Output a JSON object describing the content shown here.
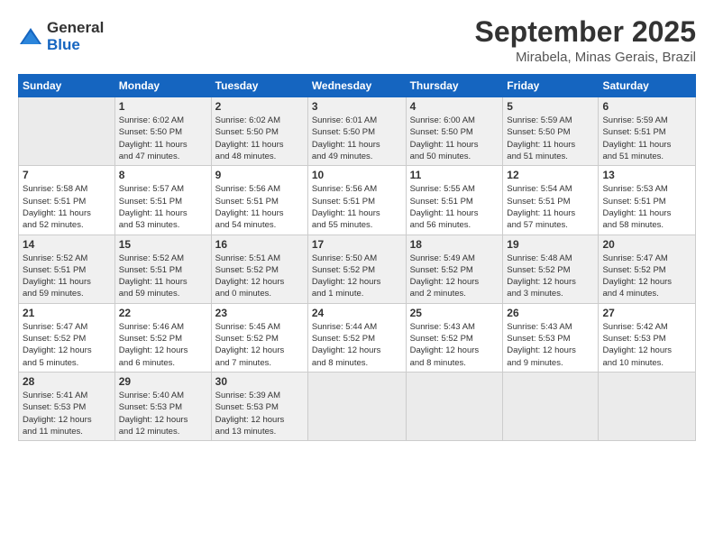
{
  "logo": {
    "general": "General",
    "blue": "Blue"
  },
  "title": "September 2025",
  "subtitle": "Mirabela, Minas Gerais, Brazil",
  "weekdays": [
    "Sunday",
    "Monday",
    "Tuesday",
    "Wednesday",
    "Thursday",
    "Friday",
    "Saturday"
  ],
  "weeks": [
    [
      {
        "day": "",
        "info": ""
      },
      {
        "day": "1",
        "info": "Sunrise: 6:02 AM\nSunset: 5:50 PM\nDaylight: 11 hours\nand 47 minutes."
      },
      {
        "day": "2",
        "info": "Sunrise: 6:02 AM\nSunset: 5:50 PM\nDaylight: 11 hours\nand 48 minutes."
      },
      {
        "day": "3",
        "info": "Sunrise: 6:01 AM\nSunset: 5:50 PM\nDaylight: 11 hours\nand 49 minutes."
      },
      {
        "day": "4",
        "info": "Sunrise: 6:00 AM\nSunset: 5:50 PM\nDaylight: 11 hours\nand 50 minutes."
      },
      {
        "day": "5",
        "info": "Sunrise: 5:59 AM\nSunset: 5:50 PM\nDaylight: 11 hours\nand 51 minutes."
      },
      {
        "day": "6",
        "info": "Sunrise: 5:59 AM\nSunset: 5:51 PM\nDaylight: 11 hours\nand 51 minutes."
      }
    ],
    [
      {
        "day": "7",
        "info": "Sunrise: 5:58 AM\nSunset: 5:51 PM\nDaylight: 11 hours\nand 52 minutes."
      },
      {
        "day": "8",
        "info": "Sunrise: 5:57 AM\nSunset: 5:51 PM\nDaylight: 11 hours\nand 53 minutes."
      },
      {
        "day": "9",
        "info": "Sunrise: 5:56 AM\nSunset: 5:51 PM\nDaylight: 11 hours\nand 54 minutes."
      },
      {
        "day": "10",
        "info": "Sunrise: 5:56 AM\nSunset: 5:51 PM\nDaylight: 11 hours\nand 55 minutes."
      },
      {
        "day": "11",
        "info": "Sunrise: 5:55 AM\nSunset: 5:51 PM\nDaylight: 11 hours\nand 56 minutes."
      },
      {
        "day": "12",
        "info": "Sunrise: 5:54 AM\nSunset: 5:51 PM\nDaylight: 11 hours\nand 57 minutes."
      },
      {
        "day": "13",
        "info": "Sunrise: 5:53 AM\nSunset: 5:51 PM\nDaylight: 11 hours\nand 58 minutes."
      }
    ],
    [
      {
        "day": "14",
        "info": "Sunrise: 5:52 AM\nSunset: 5:51 PM\nDaylight: 11 hours\nand 59 minutes."
      },
      {
        "day": "15",
        "info": "Sunrise: 5:52 AM\nSunset: 5:51 PM\nDaylight: 11 hours\nand 59 minutes."
      },
      {
        "day": "16",
        "info": "Sunrise: 5:51 AM\nSunset: 5:52 PM\nDaylight: 12 hours\nand 0 minutes."
      },
      {
        "day": "17",
        "info": "Sunrise: 5:50 AM\nSunset: 5:52 PM\nDaylight: 12 hours\nand 1 minute."
      },
      {
        "day": "18",
        "info": "Sunrise: 5:49 AM\nSunset: 5:52 PM\nDaylight: 12 hours\nand 2 minutes."
      },
      {
        "day": "19",
        "info": "Sunrise: 5:48 AM\nSunset: 5:52 PM\nDaylight: 12 hours\nand 3 minutes."
      },
      {
        "day": "20",
        "info": "Sunrise: 5:47 AM\nSunset: 5:52 PM\nDaylight: 12 hours\nand 4 minutes."
      }
    ],
    [
      {
        "day": "21",
        "info": "Sunrise: 5:47 AM\nSunset: 5:52 PM\nDaylight: 12 hours\nand 5 minutes."
      },
      {
        "day": "22",
        "info": "Sunrise: 5:46 AM\nSunset: 5:52 PM\nDaylight: 12 hours\nand 6 minutes."
      },
      {
        "day": "23",
        "info": "Sunrise: 5:45 AM\nSunset: 5:52 PM\nDaylight: 12 hours\nand 7 minutes."
      },
      {
        "day": "24",
        "info": "Sunrise: 5:44 AM\nSunset: 5:52 PM\nDaylight: 12 hours\nand 8 minutes."
      },
      {
        "day": "25",
        "info": "Sunrise: 5:43 AM\nSunset: 5:52 PM\nDaylight: 12 hours\nand 8 minutes."
      },
      {
        "day": "26",
        "info": "Sunrise: 5:43 AM\nSunset: 5:53 PM\nDaylight: 12 hours\nand 9 minutes."
      },
      {
        "day": "27",
        "info": "Sunrise: 5:42 AM\nSunset: 5:53 PM\nDaylight: 12 hours\nand 10 minutes."
      }
    ],
    [
      {
        "day": "28",
        "info": "Sunrise: 5:41 AM\nSunset: 5:53 PM\nDaylight: 12 hours\nand 11 minutes."
      },
      {
        "day": "29",
        "info": "Sunrise: 5:40 AM\nSunset: 5:53 PM\nDaylight: 12 hours\nand 12 minutes."
      },
      {
        "day": "30",
        "info": "Sunrise: 5:39 AM\nSunset: 5:53 PM\nDaylight: 12 hours\nand 13 minutes."
      },
      {
        "day": "",
        "info": ""
      },
      {
        "day": "",
        "info": ""
      },
      {
        "day": "",
        "info": ""
      },
      {
        "day": "",
        "info": ""
      }
    ]
  ]
}
